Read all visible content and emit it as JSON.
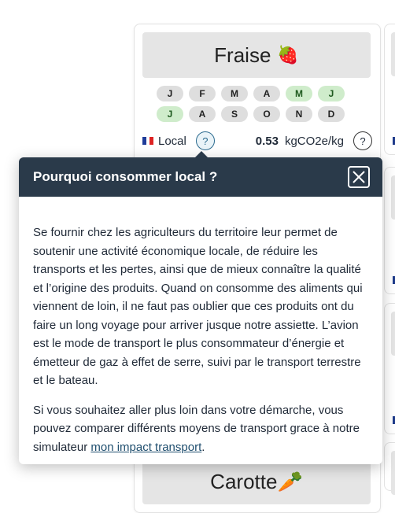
{
  "product": {
    "name": "Fraise",
    "emoji": "🍓",
    "months_row1": [
      {
        "label": "J",
        "in_season": false
      },
      {
        "label": "F",
        "in_season": false
      },
      {
        "label": "M",
        "in_season": false
      },
      {
        "label": "A",
        "in_season": false
      },
      {
        "label": "M",
        "in_season": true
      },
      {
        "label": "J",
        "in_season": true
      }
    ],
    "months_row2": [
      {
        "label": "J",
        "in_season": true
      },
      {
        "label": "A",
        "in_season": false
      },
      {
        "label": "S",
        "in_season": false
      },
      {
        "label": "O",
        "in_season": false
      },
      {
        "label": "N",
        "in_season": false
      },
      {
        "label": "D",
        "in_season": false
      }
    ],
    "origin_label": "Local",
    "help_glyph": "?",
    "co2_value": "0.53",
    "co2_unit": "kgCO2e/kg"
  },
  "next_product": {
    "name": "Carotte",
    "emoji": "🥕"
  },
  "modal": {
    "title": "Pourquoi consommer local ?",
    "paragraph1": "Se fournir chez les agriculteurs du territoire leur permet de soutenir une activité économique locale, de réduire les transports et les pertes, ainsi que de mieux connaître la qualité et l’origine des produits. Quand on consomme des aliments qui viennent de loin, il ne faut pas oublier que ces produits ont du faire un long voyage pour arriver jusque notre assiette. L’avion est le mode de transport le plus consommateur d’énergie et émetteur de gaz à effet de serre, suivi par le transport terrestre et le bateau.",
    "paragraph2_prefix": "Si vous souhaitez aller plus loin dans votre démarche, vous pouvez comparer différents moyens de transport grace à notre simulateur ",
    "link_text": "mon impact transport",
    "paragraph2_suffix": "."
  },
  "colors": {
    "modal_header": "#2a3a4a",
    "in_season": "#cfeccb",
    "off_season": "#dedede",
    "link": "#1f4e6e"
  }
}
